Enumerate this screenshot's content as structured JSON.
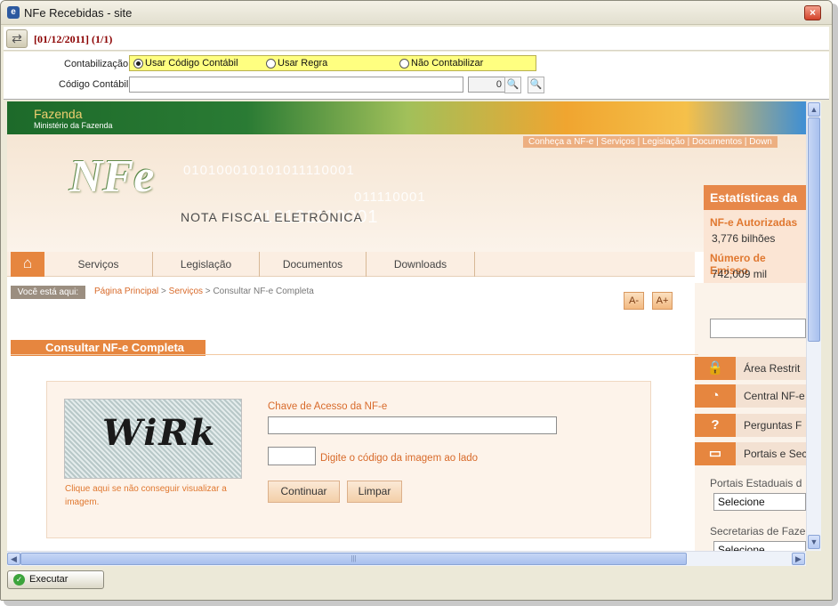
{
  "window": {
    "title": "NFe Recebidas - site",
    "close_glyph": "×"
  },
  "nav": {
    "date_label": "[01/12/2011] (1/1)",
    "arrows_glyph": "⇄"
  },
  "filters": {
    "contabilizacao_label": "Contabilização",
    "radio_options": [
      {
        "label": "Usar Código Contábil",
        "checked": true
      },
      {
        "label": "Usar Regra",
        "checked": false
      },
      {
        "label": "Não Contabilizar",
        "checked": false
      }
    ],
    "codigo_label": "Código Contábil",
    "codigo_value": "",
    "codigo_number": "0",
    "search_icon": "magnifier-icon",
    "search_glyph": "🔍",
    "view_glyph": "🔍"
  },
  "site": {
    "brand": "Fazenda",
    "brand_sub": "Ministério da Fazenda",
    "top_links": "Conheça a NF-e  |  Serviços  |  Legislação  |  Documentos  |  Down",
    "logo_text": "NFe",
    "logo_sub": "NOTA FISCAL ELETRÔNICA",
    "binary_1": "010100010101011110001",
    "binary_2": "010101110001",
    "binary_3": "011110001",
    "home_glyph": "⌂",
    "menu": [
      "Serviços",
      "Legislação",
      "Documentos",
      "Downloads"
    ],
    "breadcrumb_label": "Você está aqui:",
    "breadcrumb_home": "Página Principal",
    "breadcrumb_sep": " > ",
    "breadcrumb_services": "Serviços",
    "breadcrumb_current": "Consultar NF-e Completa",
    "font_minus": "A-",
    "font_plus": "A+",
    "section_title": "Consultar NF-e Completa",
    "captcha_text": "WiRk",
    "captcha_help": "Clique aqui se não conseguir visualizar a imagem.",
    "chave_label": "Chave de Acesso da NF-e",
    "code_label": "Digite o código da imagem ao lado",
    "btn_continuar": "Continuar",
    "btn_limpar": "Limpar",
    "stats_title": "Estatísticas da N",
    "stats": [
      {
        "label": "NF-e Autorizadas",
        "value": "3,776 bilhões"
      },
      {
        "label": "Número de Emisso",
        "value": "742,009 mil"
      }
    ],
    "side_items": [
      {
        "icon": "lock-icon",
        "glyph": "🔒",
        "label": "Área Restrit"
      },
      {
        "icon": "headset-icon",
        "glyph": "◔",
        "label": "Central NF-e"
      },
      {
        "icon": "question-icon",
        "glyph": "?",
        "label": "Perguntas F"
      },
      {
        "icon": "portal-icon",
        "glyph": "▭",
        "label": "Portais e Sec"
      }
    ],
    "portais_label": "Portais Estaduais d",
    "portais_value": "Selecione",
    "secretarias_label": "Secretarias de Faze",
    "secretarias_value": "Selecione"
  },
  "scroll": {
    "up": "▲",
    "down": "▼",
    "left": "◀",
    "right": "▶",
    "grip": "|||",
    "vgrip": "≡"
  },
  "bottom": {
    "execute_label": "Executar",
    "execute_glyph": "✓"
  }
}
